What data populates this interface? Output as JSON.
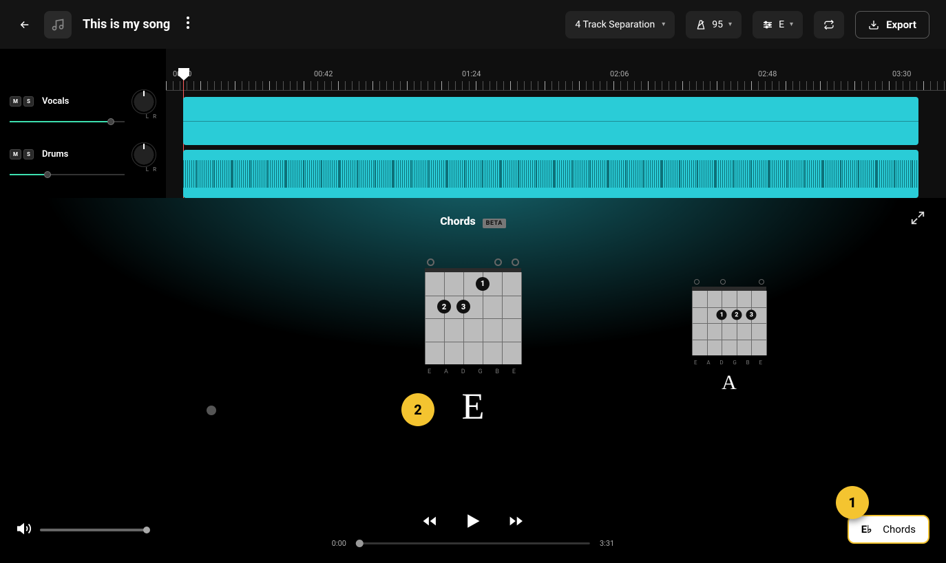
{
  "header": {
    "song_title": "This is my song",
    "separation_label": "4 Track Separation",
    "tempo": "95",
    "key": "E",
    "export_label": "Export"
  },
  "timeline": {
    "labels": [
      "00:00",
      "00:42",
      "01:24",
      "02:06",
      "02:48",
      "03:30"
    ]
  },
  "tracks": [
    {
      "name": "Vocals",
      "mute": "M",
      "solo": "S",
      "l": "L",
      "r": "R",
      "vol_pct": 85
    },
    {
      "name": "Drums",
      "mute": "M",
      "solo": "S",
      "l": "L",
      "r": "R",
      "vol_pct": 30
    }
  ],
  "chord_panel": {
    "title": "Chords",
    "badge": "BETA",
    "string_labels": [
      "E",
      "A",
      "D",
      "G",
      "B",
      "E"
    ],
    "current": {
      "name": "E",
      "fingers": [
        "1",
        "2",
        "3"
      ]
    },
    "next": {
      "name": "A",
      "fingers": [
        "1",
        "2",
        "3"
      ]
    },
    "callouts": {
      "panel": "2",
      "pill": "1"
    }
  },
  "playback": {
    "current": "0:00",
    "total": "3:31",
    "pill_lyrics": "E♭",
    "pill_chords": "Chords"
  }
}
